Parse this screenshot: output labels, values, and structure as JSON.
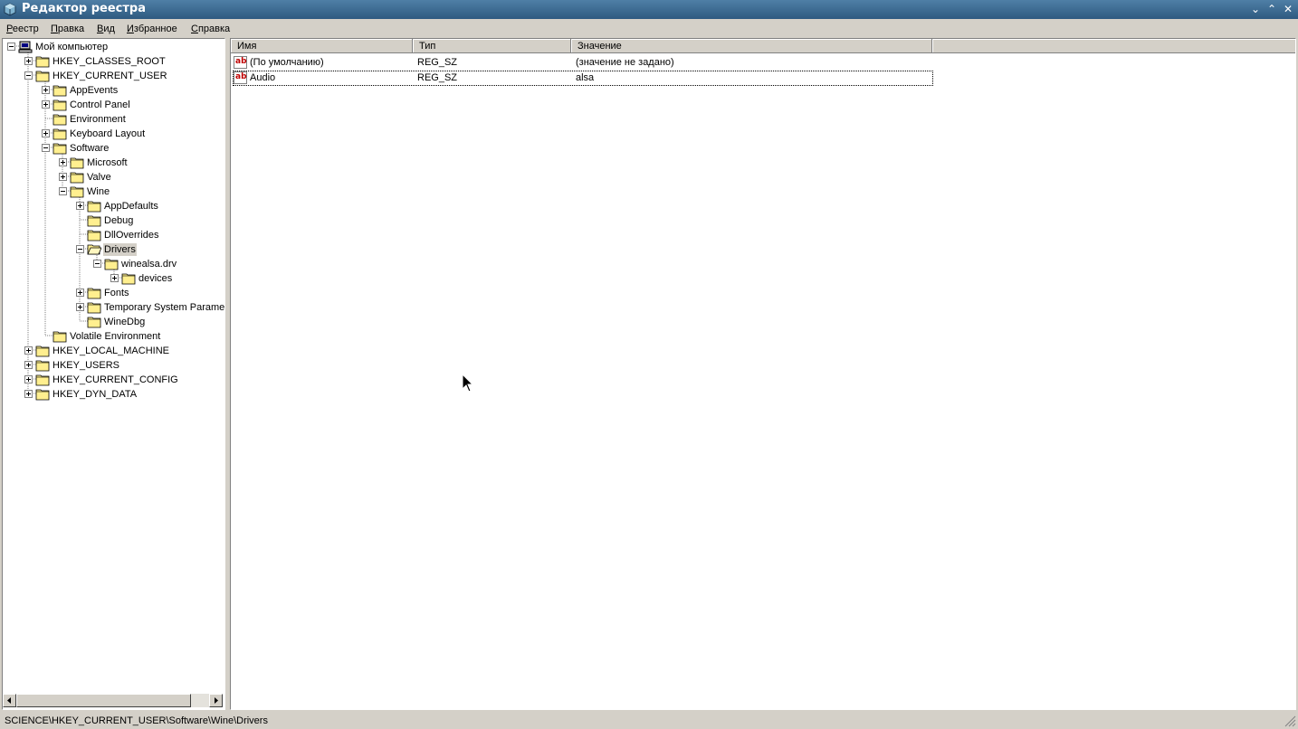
{
  "window": {
    "title": "Редактор реестра",
    "minimize_glyph": "⌄",
    "maximize_glyph": "⌃",
    "close_glyph": "✕"
  },
  "menu": {
    "items": [
      {
        "label": "Реестр"
      },
      {
        "label": "Правка"
      },
      {
        "label": "Вид"
      },
      {
        "label": "Избранное"
      },
      {
        "label": "Справка"
      }
    ]
  },
  "tree": {
    "items": [
      {
        "label": "Мой компьютер",
        "level": 0,
        "state": "expanded",
        "icon": "computer-icon"
      },
      {
        "label": "HKEY_CLASSES_ROOT",
        "level": 1,
        "state": "collapsed",
        "icon": "folder-icon"
      },
      {
        "label": "HKEY_CURRENT_USER",
        "level": 1,
        "state": "expanded",
        "icon": "folder-icon"
      },
      {
        "label": "AppEvents",
        "level": 2,
        "state": "collapsed",
        "icon": "folder-icon"
      },
      {
        "label": "Control Panel",
        "level": 2,
        "state": "collapsed",
        "icon": "folder-icon"
      },
      {
        "label": "Environment",
        "level": 2,
        "state": "leaf",
        "icon": "folder-icon"
      },
      {
        "label": "Keyboard Layout",
        "level": 2,
        "state": "collapsed",
        "icon": "folder-icon"
      },
      {
        "label": "Software",
        "level": 2,
        "state": "expanded",
        "icon": "folder-icon"
      },
      {
        "label": "Microsoft",
        "level": 3,
        "state": "collapsed",
        "icon": "folder-icon"
      },
      {
        "label": "Valve",
        "level": 3,
        "state": "collapsed",
        "icon": "folder-icon"
      },
      {
        "label": "Wine",
        "level": 3,
        "state": "expanded",
        "icon": "folder-icon"
      },
      {
        "label": "AppDefaults",
        "level": 4,
        "state": "collapsed",
        "icon": "folder-icon"
      },
      {
        "label": "Debug",
        "level": 4,
        "state": "leaf",
        "icon": "folder-icon"
      },
      {
        "label": "DllOverrides",
        "level": 4,
        "state": "leaf",
        "icon": "folder-icon"
      },
      {
        "label": "Drivers",
        "level": 4,
        "state": "expanded",
        "icon": "folder-open-icon",
        "selected": true
      },
      {
        "label": "winealsa.drv",
        "level": 5,
        "state": "expanded",
        "icon": "folder-icon"
      },
      {
        "label": "devices",
        "level": 6,
        "state": "collapsed",
        "icon": "folder-icon"
      },
      {
        "label": "Fonts",
        "level": 4,
        "state": "collapsed",
        "icon": "folder-icon"
      },
      {
        "label": "Temporary System Paramet",
        "level": 4,
        "state": "collapsed",
        "icon": "folder-icon"
      },
      {
        "label": "WineDbg",
        "level": 4,
        "state": "leaf",
        "icon": "folder-icon"
      },
      {
        "label": "Volatile Environment",
        "level": 2,
        "state": "leaf",
        "icon": "folder-icon"
      },
      {
        "label": "HKEY_LOCAL_MACHINE",
        "level": 1,
        "state": "collapsed",
        "icon": "folder-icon"
      },
      {
        "label": "HKEY_USERS",
        "level": 1,
        "state": "collapsed",
        "icon": "folder-icon"
      },
      {
        "label": "HKEY_CURRENT_CONFIG",
        "level": 1,
        "state": "collapsed",
        "icon": "folder-icon"
      },
      {
        "label": "HKEY_DYN_DATA",
        "level": 1,
        "state": "collapsed",
        "icon": "folder-icon"
      }
    ]
  },
  "list": {
    "columns": [
      {
        "label": "Имя"
      },
      {
        "label": "Тип"
      },
      {
        "label": "Значение"
      }
    ],
    "rows": [
      {
        "name": "(По умолчанию)",
        "type": "REG_SZ",
        "value": "(значение не задано)",
        "icon": "string-value-icon"
      },
      {
        "name": "Audio",
        "type": "REG_SZ",
        "value": "alsa",
        "icon": "string-value-icon",
        "focused": true
      }
    ]
  },
  "status": {
    "path": "SCIENCE\\HKEY_CURRENT_USER\\Software\\Wine\\Drivers"
  },
  "colors": {
    "titlebar": "#3d6b92",
    "face": "#d4d0c8",
    "folder": "#ffef8f"
  }
}
